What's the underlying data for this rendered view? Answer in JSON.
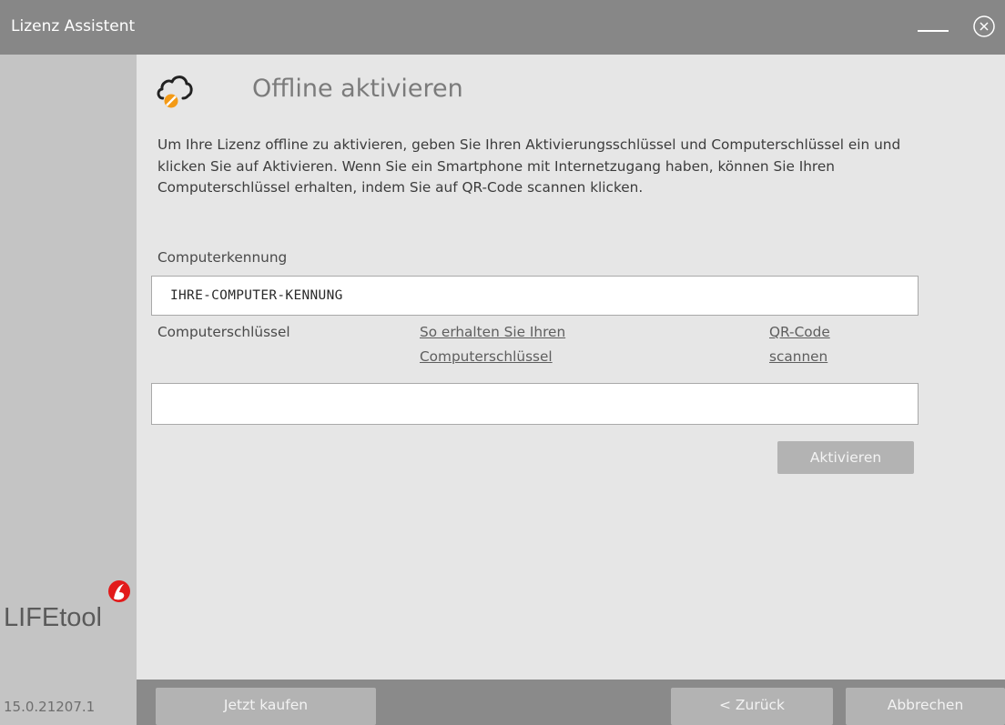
{
  "window": {
    "title": "Lizenz Assistent"
  },
  "sidebar": {
    "logo_text": "LIFEtool",
    "version": "15.0.21207.1"
  },
  "main": {
    "title": "Offline aktivieren",
    "description": "Um Ihre Lizenz offline zu aktivieren, geben Sie Ihren Aktivierungsschlüssel und Computerschlüssel ein und klicken Sie auf Aktivieren. Wenn Sie ein Smartphone mit Internetzugang haben, können Sie Ihren Computerschlüssel erhalten, indem Sie auf QR-Code scannen klicken.",
    "computer_id_label": "Computerkennung",
    "computer_id_value": "IHRE-COMPUTER-KENNUNG",
    "computer_key_label": "Computerschlüssel",
    "how_to_link": "So erhalten Sie Ihren Computerschlüssel",
    "qr_link": "QR-Code scannen",
    "computer_key_value": "",
    "activate_button": "Aktivieren"
  },
  "footer": {
    "buy_button": "Jetzt kaufen",
    "back_button": "< Zurück",
    "cancel_button": "Abbrechen"
  },
  "colors": {
    "titlebar": "#878787",
    "sidebar": "#c4c4c4",
    "content": "#e6e6e6",
    "accent_orange": "#f39a16",
    "logo_red": "#e21a1a",
    "button": "#b3b3b3"
  },
  "icons": {
    "header": "cloud-blocked-icon",
    "minimize": "minimize-icon",
    "close": "close-circle-icon"
  }
}
